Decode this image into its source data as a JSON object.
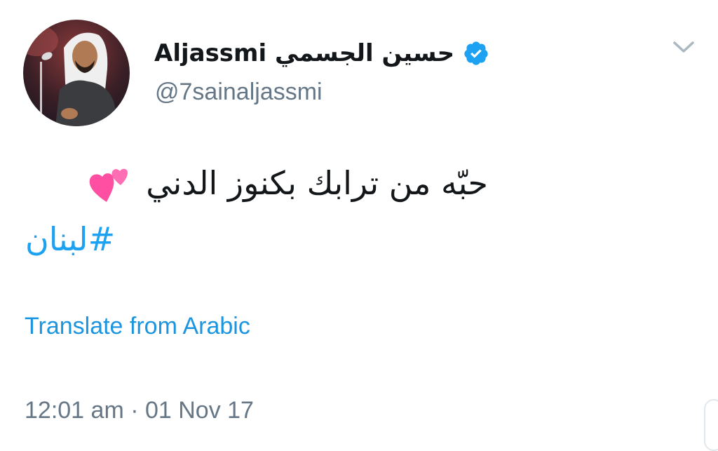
{
  "author": {
    "display_name": "Aljassmi حسين الجسمي",
    "handle": "@7sainaljassmi",
    "verified": true,
    "avatar_icon": "singer-avatar"
  },
  "tweet": {
    "text": "حبّه من ترابك بكنوز الدني",
    "emoji_icon": "two-hearts-icon",
    "hashtag": "#لبنان",
    "translate_label": "Translate from Arabic",
    "timestamp": "12:01 am · 01 Nov 17"
  },
  "colors": {
    "link": "#1da1f2",
    "verified_badge": "#1da1f2",
    "secondary_text": "#657786",
    "primary_text": "#14171a"
  }
}
